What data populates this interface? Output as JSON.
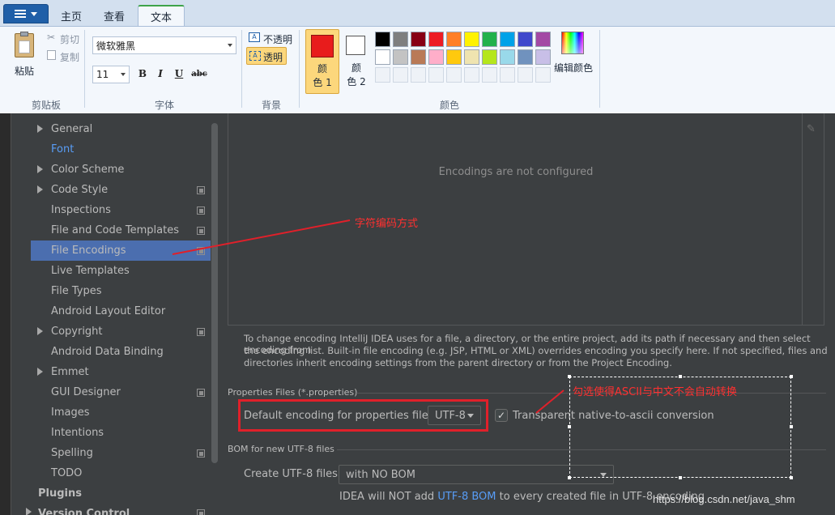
{
  "ribbon": {
    "tabs": [
      {
        "label": "主页"
      },
      {
        "label": "查看"
      },
      {
        "label": "文本"
      }
    ],
    "clipboard": {
      "paste": "粘贴",
      "cut": "剪切",
      "copy": "复制",
      "group": "剪贴板"
    },
    "font": {
      "family": "微软雅黑",
      "size": "11",
      "bold": "B",
      "italic": "I",
      "underline": "U",
      "strike": "abc",
      "group": "字体"
    },
    "background": {
      "opaque": "不透明",
      "transparent": "透明",
      "group": "背景"
    },
    "colors": {
      "color1": "颜\n色 1",
      "color2": "颜\n色 2",
      "edit": "编辑颜色",
      "group": "颜色",
      "color1_value": "#e81c1c",
      "color2_value": "#ffffff",
      "palette_row1": [
        "#000000",
        "#7f7f7f",
        "#880015",
        "#ed1c24",
        "#ff7f27",
        "#fff200",
        "#22b14c",
        "#00a2e8",
        "#3f48cc",
        "#a349a4"
      ],
      "palette_row2": [
        "#ffffff",
        "#c3c3c3",
        "#b97a57",
        "#ffaec9",
        "#ffc90e",
        "#efe4b0",
        "#b5e61d",
        "#99d9ea",
        "#7092be",
        "#c8bfe7"
      ]
    }
  },
  "sidebar": {
    "items": [
      {
        "label": "General",
        "expandable": true,
        "copy": false
      },
      {
        "label": "Font",
        "expandable": false,
        "copy": false,
        "link": true
      },
      {
        "label": "Color Scheme",
        "expandable": true,
        "copy": false
      },
      {
        "label": "Code Style",
        "expandable": true,
        "copy": true
      },
      {
        "label": "Inspections",
        "expandable": false,
        "copy": true
      },
      {
        "label": "File and Code Templates",
        "expandable": false,
        "copy": true
      },
      {
        "label": "File Encodings",
        "expandable": false,
        "copy": true,
        "selected": true
      },
      {
        "label": "Live Templates",
        "expandable": false,
        "copy": false
      },
      {
        "label": "File Types",
        "expandable": false,
        "copy": false
      },
      {
        "label": "Android Layout Editor",
        "expandable": false,
        "copy": false
      },
      {
        "label": "Copyright",
        "expandable": true,
        "copy": true
      },
      {
        "label": "Android Data Binding",
        "expandable": false,
        "copy": false
      },
      {
        "label": "Emmet",
        "expandable": true,
        "copy": false
      },
      {
        "label": "GUI Designer",
        "expandable": false,
        "copy": true
      },
      {
        "label": "Images",
        "expandable": false,
        "copy": false
      },
      {
        "label": "Intentions",
        "expandable": false,
        "copy": false
      },
      {
        "label": "Spelling",
        "expandable": false,
        "copy": true
      },
      {
        "label": "TODO",
        "expandable": false,
        "copy": false
      }
    ],
    "plugins": "Plugins",
    "version_control": "Version Control"
  },
  "main": {
    "empty_table": "Encodings are not configured",
    "description_lines": [
      "To change encoding IntelliJ IDEA uses for a file, a directory, or the entire project, add its path if necessary and then select encoding from",
      "the encoding list. Built-in file encoding (e.g. JSP, HTML or XML) overrides encoding you specify here. If not specified, files and",
      "directories inherit encoding settings from the parent directory or from the Project Encoding."
    ],
    "properties_section": "Properties Files (*.properties)",
    "default_encoding_label": "Default encoding for properties files:",
    "default_encoding_value": "UTF-8",
    "transparent_label": "Transparent native-to-ascii conversion",
    "transparent_checked": true,
    "bom_section": "BOM for new UTF-8 files",
    "create_utf8_label": "Create UTF-8 files:",
    "create_utf8_value": "with NO BOM",
    "bom_note_prefix": "IDEA will NOT add ",
    "bom_note_link": "UTF-8 BOM",
    "bom_note_suffix": " to every created file in UTF-8 encoding"
  },
  "annotations": {
    "encoding_note": "字符编码方式",
    "ascii_note": "勾选使得ASCII与中文不会自动转换",
    "watermark": "https://blog.csdn.net/java_shm"
  }
}
